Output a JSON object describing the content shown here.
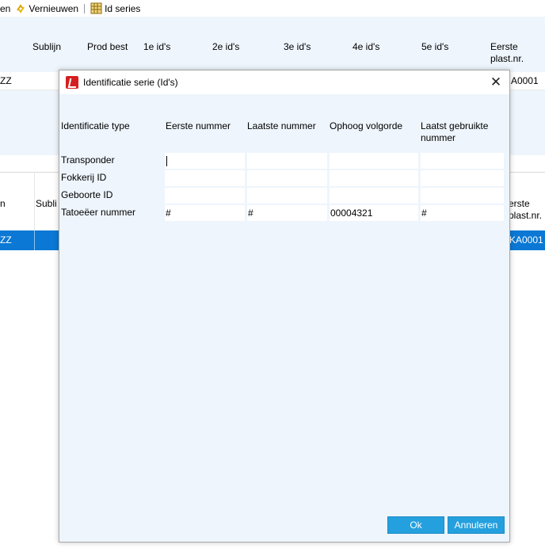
{
  "toolbar": {
    "item0": "en",
    "refresh": "Vernieuwen",
    "id_series": "Id series",
    "icons": {
      "refresh": "refresh-arrows-icon",
      "id_series": "grid-table-icon"
    }
  },
  "grid1": {
    "columns": [
      "Sublijn",
      "Prod best",
      "1e id's",
      "2e id's",
      "3e id's",
      "4e id's",
      "5e id's",
      "Eerste plast.nr."
    ],
    "row1": {
      "c0": "ZZ",
      "last": "A0001"
    }
  },
  "grid2": {
    "col_left": "n",
    "col_sublijn": "Subli",
    "col_right": "erste plast.nr.",
    "row": {
      "c0": "ZZ",
      "last": "KA0001"
    }
  },
  "dialog": {
    "title": "Identificatie serie  (Id's)",
    "close": "✕",
    "headers": [
      "Identificatie type",
      "Eerste nummer",
      "Laatste nummer",
      "Ophoog volgorde",
      "Laatst gebruikte nummer"
    ],
    "rows": [
      {
        "type": "Transponder",
        "eerste": "",
        "laatste": "",
        "ophoog": "",
        "laatst": ""
      },
      {
        "type": "Fokkerij ID",
        "eerste": "",
        "laatste": "",
        "ophoog": "",
        "laatst": ""
      },
      {
        "type": "Geboorte ID",
        "eerste": "",
        "laatste": "",
        "ophoog": "",
        "laatst": ""
      },
      {
        "type": "Tatoeëer nummer",
        "eerste": "#",
        "laatste": "#",
        "ophoog": "00004321",
        "laatst": "#"
      }
    ],
    "ok": "Ok",
    "cancel": "Annuleren",
    "accent": "#25a0de",
    "logo_color": "#d42020"
  }
}
